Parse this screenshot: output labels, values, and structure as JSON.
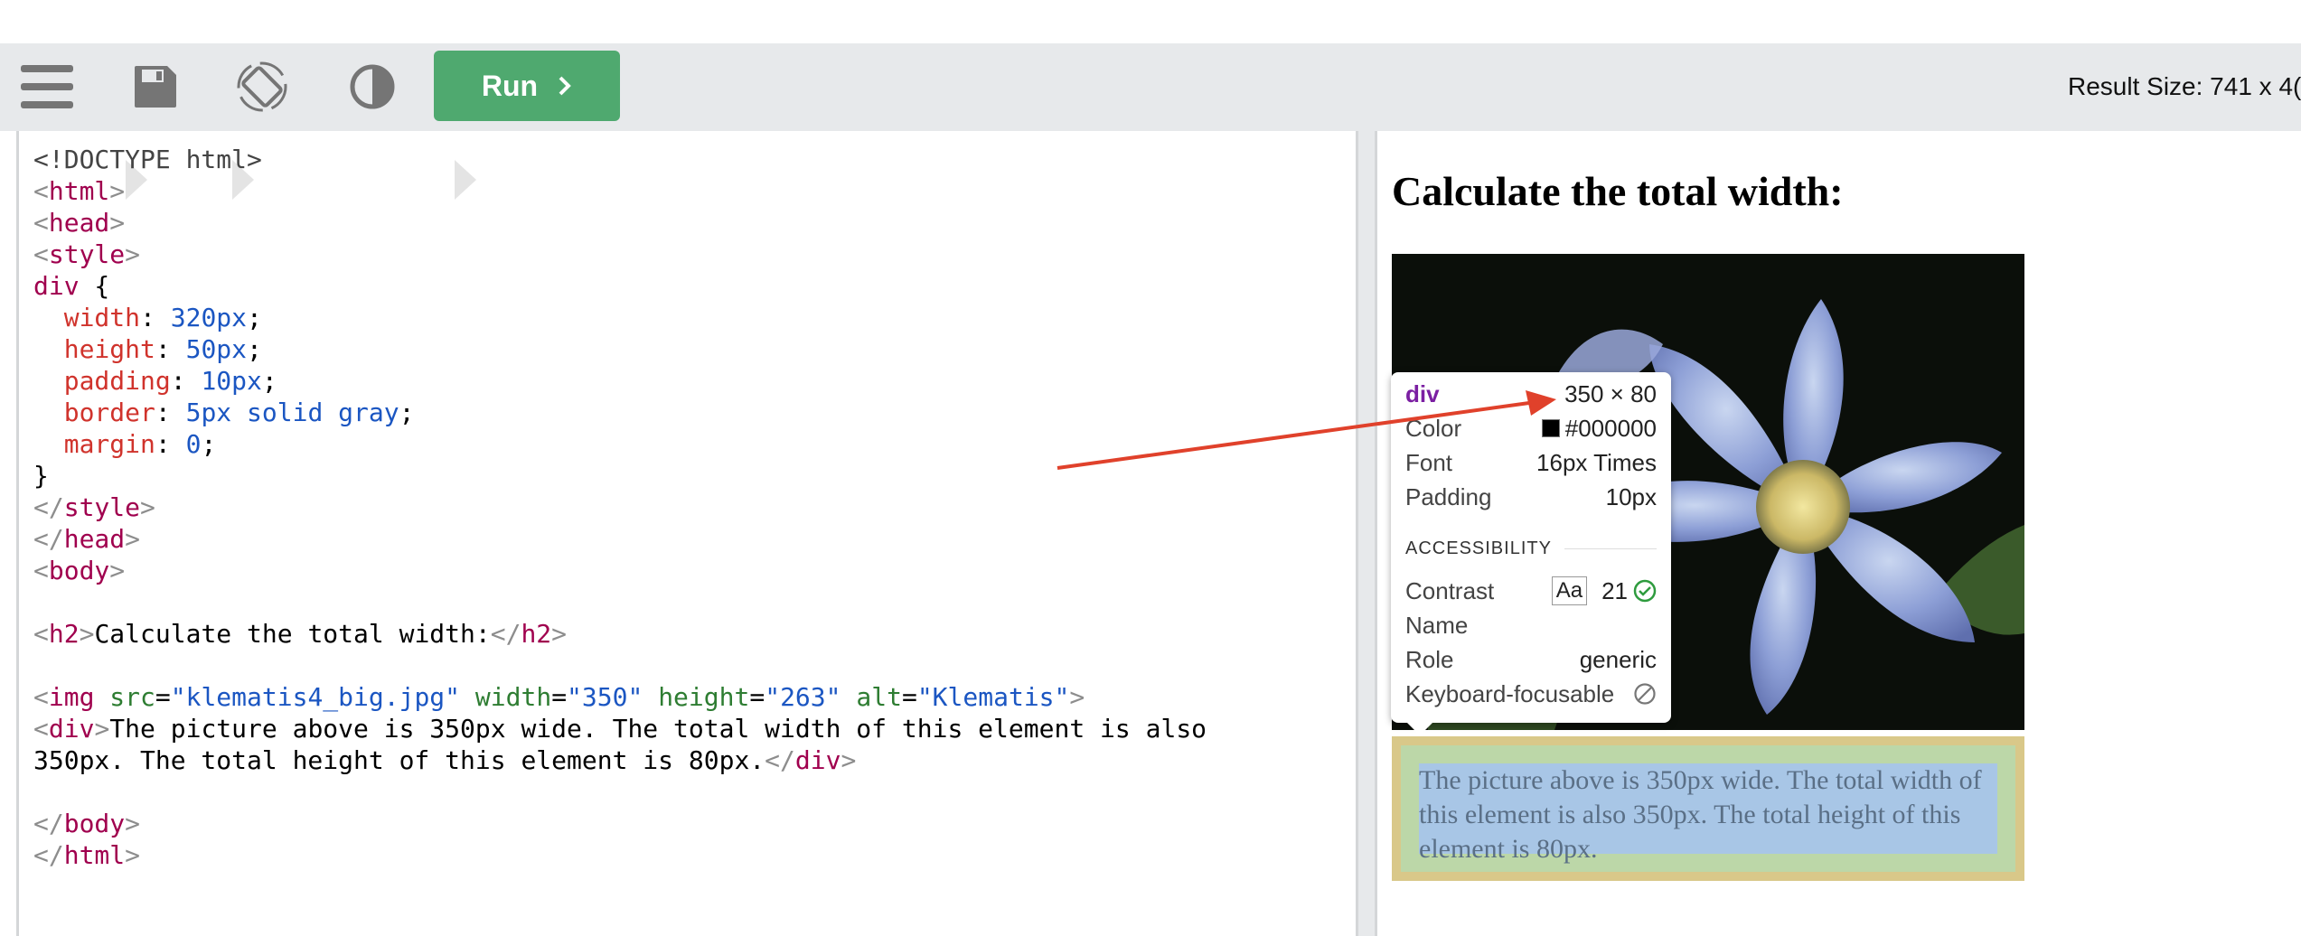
{
  "toolbar": {
    "menu_icon": "hamburger-menu-icon",
    "save_icon": "floppy-disk-icon",
    "rotate_icon": "rotate-screen-icon",
    "theme_icon": "contrast-icon",
    "run_label": "Run",
    "result_size": "Result Size: 741 x 4("
  },
  "editor": {
    "lines": [
      "<!DOCTYPE html>",
      "<html>",
      "<head>",
      "<style>",
      "div {",
      "  width: 320px;",
      "  height: 50px;",
      "  padding: 10px;",
      "  border: 5px solid gray;",
      "  margin: 0;",
      "}",
      "</style>",
      "</head>",
      "<body>",
      "",
      "<h2>Calculate the total width:</h2>",
      "",
      "<img src=\"klematis4_big.jpg\" width=\"350\" height=\"263\" alt=\"Klematis\">",
      "<div>The picture above is 350px wide. The total width of this element is also",
      "350px. The total height of this element is 80px.</div>",
      "",
      "</body>",
      "</html>"
    ]
  },
  "result": {
    "heading": "Calculate the total width:",
    "div_text": "The picture above is 350px wide. The total width of this element is also 350px. The total height of this element is 80px."
  },
  "tooltip": {
    "tag": "div",
    "size": "350 × 80",
    "color_label": "Color",
    "color_value": "#000000",
    "font_label": "Font",
    "font_value": "16px Times",
    "padding_label": "Padding",
    "padding_value": "10px",
    "section": "ACCESSIBILITY",
    "contrast_label": "Contrast",
    "contrast_aa": "Aa",
    "contrast_value": "21",
    "name_label": "Name",
    "role_label": "Role",
    "role_value": "generic",
    "keyboard_label": "Keyboard-focusable"
  },
  "colors": {
    "run_button": "#4fa96f",
    "annotation_arrow": "#e0412b",
    "toolbar_bg": "#e7e9eb"
  }
}
